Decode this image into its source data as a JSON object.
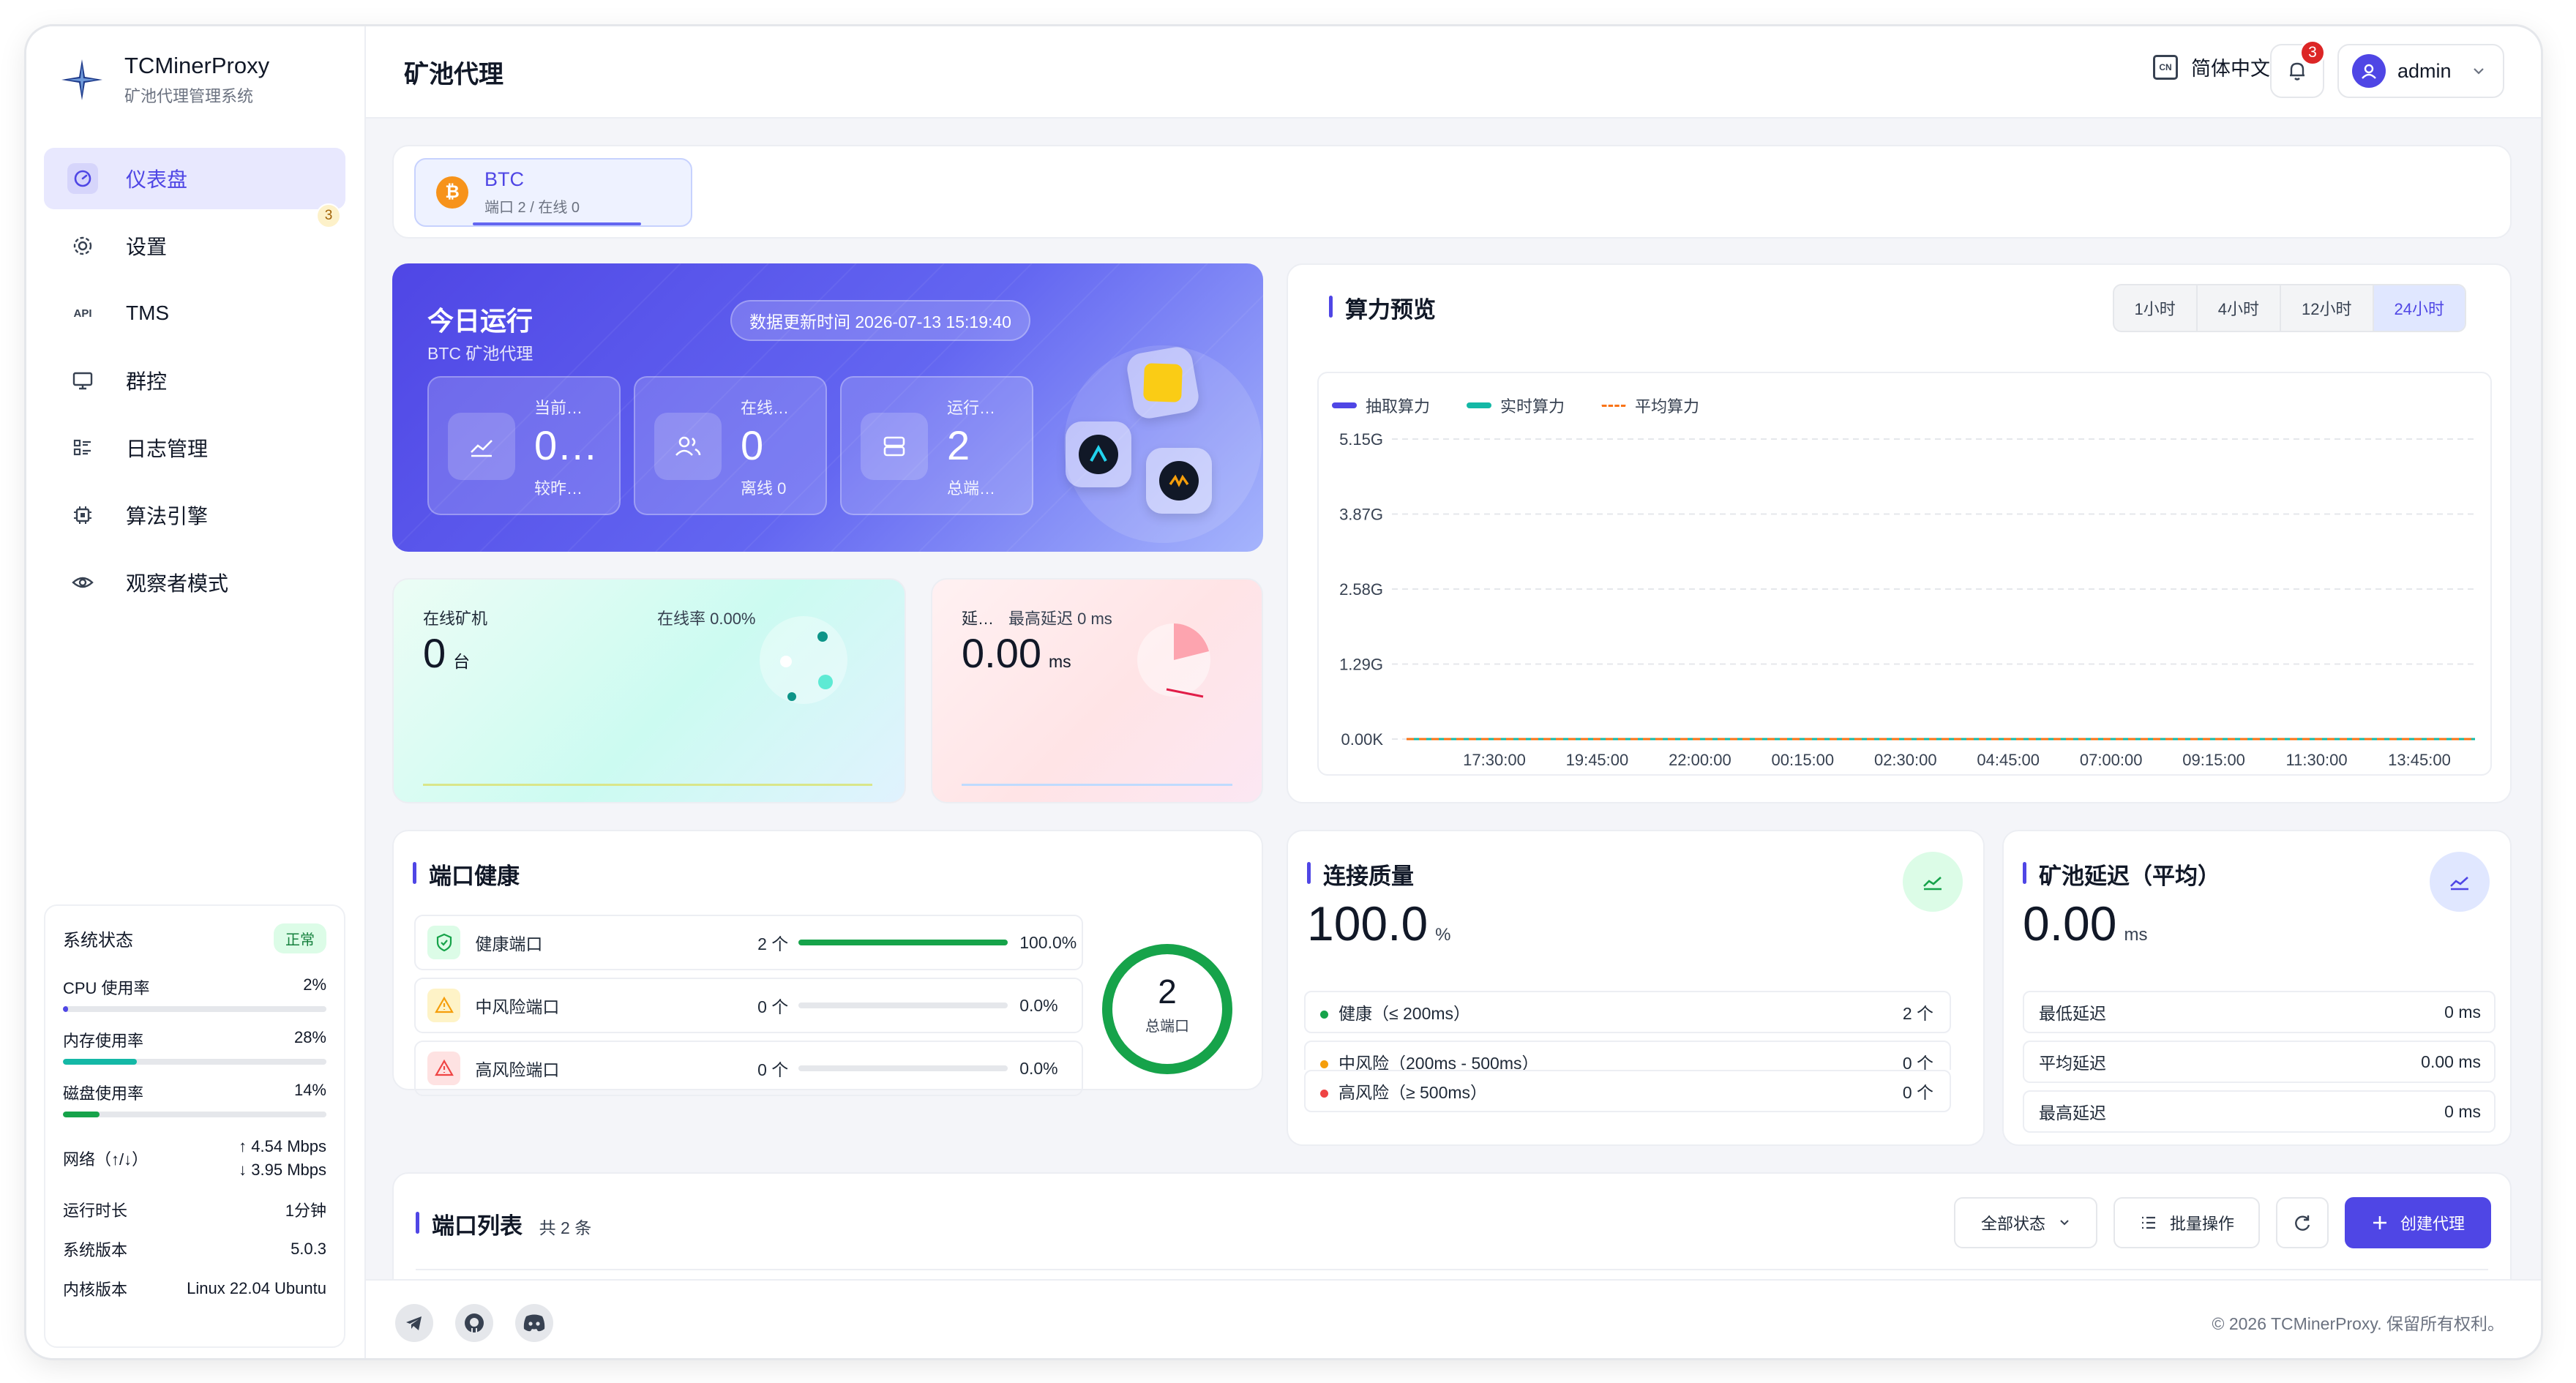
{
  "brand": {
    "name": "TCMinerProxy",
    "subtitle": "矿池代理管理系统"
  },
  "nav": [
    {
      "label": "仪表盘",
      "icon": "dashboard-icon",
      "active": true
    },
    {
      "label": "设置",
      "icon": "gear-icon",
      "badge": "3"
    },
    {
      "label": "TMS",
      "icon": "api-icon",
      "icon_text": "API"
    },
    {
      "label": "群控",
      "icon": "monitor-icon"
    },
    {
      "label": "日志管理",
      "icon": "list-icon"
    },
    {
      "label": "算法引擎",
      "icon": "chip-icon"
    },
    {
      "label": "观察者模式",
      "icon": "eye-icon"
    }
  ],
  "system": {
    "title": "系统状态",
    "status": "正常",
    "metrics": [
      {
        "label": "CPU 使用率",
        "value": "2%",
        "percent": 2,
        "color": "#4f46e5"
      },
      {
        "label": "内存使用率",
        "value": "28%",
        "percent": 28,
        "color": "#14b8a6"
      },
      {
        "label": "磁盘使用率",
        "value": "14%",
        "percent": 14,
        "color": "#16a34a"
      }
    ],
    "network_label": "网络（↑/↓）",
    "network_up": "↑ 4.54 Mbps",
    "network_down": "↓ 3.95 Mbps",
    "uptime_label": "运行时长",
    "uptime": "1分钟",
    "version_label": "系统版本",
    "version": "5.0.3",
    "kernel_label": "内核版本",
    "kernel": "Linux 22.04 Ubuntu"
  },
  "topbar": {
    "title": "矿池代理",
    "lang_icon": "CN",
    "lang": "简体中文",
    "notif_count": "3",
    "user": "admin"
  },
  "coin": {
    "symbol": "₿",
    "name": "BTC",
    "sub": "端口 2 / 在线 0"
  },
  "hero": {
    "title": "今日运行",
    "subtitle": "BTC 矿池代理",
    "update": "数据更新时间 2026-07-13 15:19:40",
    "stats": [
      {
        "label": "当前…",
        "value": "0…",
        "sub": "较昨…",
        "icon": "trend-icon"
      },
      {
        "label": "在线…",
        "value": "0",
        "sub": "离线 0",
        "icon": "users-icon"
      },
      {
        "label": "运行…",
        "value": "2",
        "sub": "总端…",
        "icon": "server-icon"
      }
    ]
  },
  "miners": {
    "label": "在线矿机",
    "value": "0",
    "unit": "台",
    "rate": "在线率 0.00%"
  },
  "latency_mini": {
    "label": "延…",
    "max": "最高延迟 0 ms",
    "value": "0.00",
    "unit": "ms"
  },
  "hashrate": {
    "title": "算力预览",
    "ranges": [
      "1小时",
      "4小时",
      "12小时",
      "24小时"
    ],
    "active_range": "24小时"
  },
  "chart_data": {
    "type": "line",
    "title": "算力预览",
    "x": [
      "17:30:00",
      "19:45:00",
      "22:00:00",
      "00:15:00",
      "02:30:00",
      "04:45:00",
      "07:00:00",
      "09:15:00",
      "11:30:00",
      "13:45:00"
    ],
    "y_ticks": [
      "5.15G",
      "3.87G",
      "2.58G",
      "1.29G",
      "0.00K"
    ],
    "ylim": [
      0,
      5.15
    ],
    "series": [
      {
        "name": "抽取算力",
        "color": "#4f46e5",
        "values": [
          0,
          0,
          0,
          0,
          0,
          0,
          0,
          0,
          0,
          0
        ]
      },
      {
        "name": "实时算力",
        "color": "#14b8a6",
        "values": [
          0,
          0,
          0,
          0,
          0,
          0,
          0,
          0,
          0,
          0
        ]
      },
      {
        "name": "平均算力",
        "color": "#f97316",
        "values": [
          0,
          0,
          0,
          0,
          0,
          0,
          0,
          0,
          0,
          0
        ]
      }
    ],
    "grid": true,
    "legend": "top-left"
  },
  "health": {
    "title": "端口健康",
    "rows": [
      {
        "label": "健康端口",
        "count": "2 个",
        "pct": "100.0%",
        "percent": 100,
        "color": "#16a34a",
        "bg": "#dcfce7"
      },
      {
        "label": "中风险端口",
        "count": "0 个",
        "pct": "0.0%",
        "percent": 0,
        "color": "#f59e0b",
        "bg": "#fef3c7"
      },
      {
        "label": "高风险端口",
        "count": "0 个",
        "pct": "0.0%",
        "percent": 0,
        "color": "#ef4444",
        "bg": "#fee2e2"
      }
    ],
    "total": "2",
    "total_label": "总端口",
    "ring_fraction": 1
  },
  "quality": {
    "title": "连接质量",
    "value": "100.0",
    "unit": "%",
    "rows": [
      {
        "label": "健康（≤ 200ms）",
        "value": "2 个",
        "color": "#16a34a"
      },
      {
        "label": "中风险（200ms - 500ms）",
        "value": "0 个",
        "color": "#f59e0b"
      },
      {
        "label": "高风险（≥ 500ms）",
        "value": "0 个",
        "color": "#ef4444"
      }
    ]
  },
  "pool_latency": {
    "title": "矿池延迟（平均）",
    "value": "0.00",
    "unit": "ms",
    "rows": [
      {
        "label": "最低延迟",
        "value": "0 ms"
      },
      {
        "label": "平均延迟",
        "value": "0.00 ms"
      },
      {
        "label": "最高延迟",
        "value": "0 ms"
      }
    ]
  },
  "ports": {
    "title": "端口列表",
    "count": "共 2 条",
    "filter": "全部状态",
    "batch": "批量操作",
    "create": "创建代理"
  },
  "footer": {
    "copyright": "© 2026 TCMinerProxy. 保留所有权利。"
  }
}
